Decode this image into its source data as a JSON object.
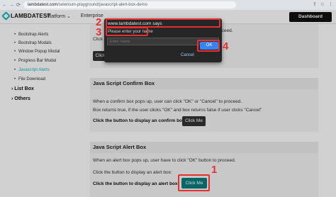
{
  "browser": {
    "back_icon": "back-arrow",
    "url_host": "lambdatest.com",
    "url_path": "/selenium-playground/javascript-alert-box-demo"
  },
  "header": {
    "logo_text": "LAMBDATEST",
    "menu": [
      "Platform ⌄",
      "Enterprise"
    ],
    "dashboard_label": "Dashboard"
  },
  "sidebar": {
    "items": [
      "Bootstrap Alerts",
      "Bootstrap Modals",
      "Window Popup Modal",
      "Progress Bar Modal",
      "Javascript Alerts",
      "File Download"
    ],
    "groups": [
      "› List Box",
      "› Others"
    ]
  },
  "top_panel": {
    "text_fragment": "oceed.",
    "click_fragment": "Click",
    "button_label": "Click Me"
  },
  "confirm_panel": {
    "title": "Java Script Confirm Box",
    "line1": "When a confirm box pops up, user can click \"OK\" or \"Cancel\" to proceed.",
    "line2": "Box returns true, if the user clicks \"OK\" and box returns false if user clicks \"Cancel\"",
    "prompt": "Click the button to display an confirm box:",
    "button_label": "Click Me"
  },
  "alert_panel": {
    "title": "Java Script Alert Box",
    "line1": "When an alert box pops up, user have to click \"OK\" button to proceed.",
    "line2": "Click the button to display an alert box:",
    "prompt": "Click the button to display an alert box:",
    "button_label": "Click Me"
  },
  "dialog": {
    "title": "www.lambdatest.com says",
    "message": "Please enter your name",
    "input_placeholder": "Enter name",
    "cancel_label": "Cancel",
    "ok_label": "OK"
  },
  "annotations": [
    "1",
    "2",
    "3",
    "4"
  ],
  "colors": {
    "accent": "#0ebac5",
    "annotation": "#e53030",
    "alert_button": "#0a7d7f"
  }
}
